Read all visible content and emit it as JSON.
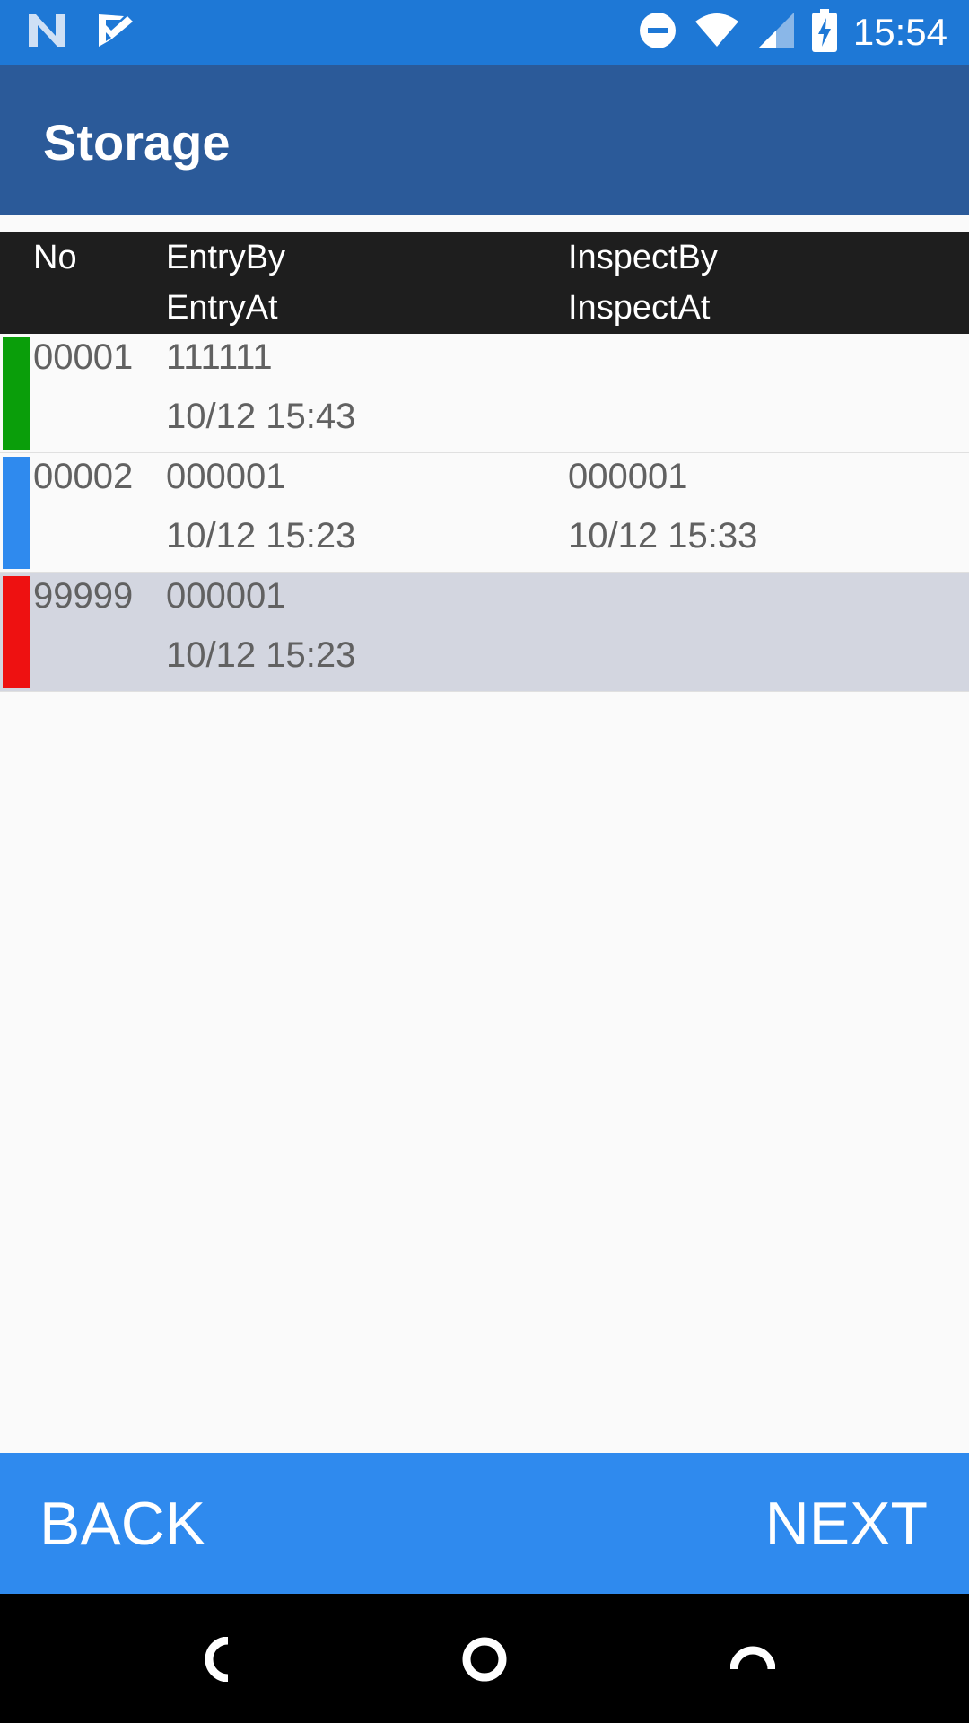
{
  "status_bar": {
    "time": "15:54",
    "icons": [
      "n-logo-icon",
      "checklist-icon",
      "do-not-disturb-icon",
      "wifi-icon",
      "cell-signal-icon",
      "battery-charging-icon"
    ]
  },
  "app_bar": {
    "title": "Storage"
  },
  "table": {
    "headers": {
      "no": "No",
      "entry_by": "EntryBy",
      "entry_at": "EntryAt",
      "inspect_by": "InspectBy",
      "inspect_at": "InspectAt"
    },
    "rows": [
      {
        "no": "00001",
        "entry_by": "111111",
        "entry_at": "10/12 15:43",
        "inspect_by": "",
        "inspect_at": "",
        "status_color": "#0a9e0a",
        "selected": false
      },
      {
        "no": "00002",
        "entry_by": "000001",
        "entry_at": "10/12 15:23",
        "inspect_by": "000001",
        "inspect_at": "10/12 15:33",
        "status_color": "#2f8aee",
        "selected": false
      },
      {
        "no": "99999",
        "entry_by": "000001",
        "entry_at": "10/12 15:23",
        "inspect_by": "",
        "inspect_at": "",
        "status_color": "#ee1111",
        "selected": true
      }
    ]
  },
  "bottom_bar": {
    "back_label": "BACK",
    "next_label": "NEXT"
  },
  "nav_bar": {
    "icons": [
      "back-nav-icon",
      "home-nav-icon",
      "recents-nav-icon"
    ]
  },
  "colors": {
    "status_bar": "#1e78d6",
    "app_bar": "#2b5a99",
    "header": "#1e1e1e",
    "bottom_bar": "#2f8aee",
    "selected_row": "#d3d6e0"
  }
}
